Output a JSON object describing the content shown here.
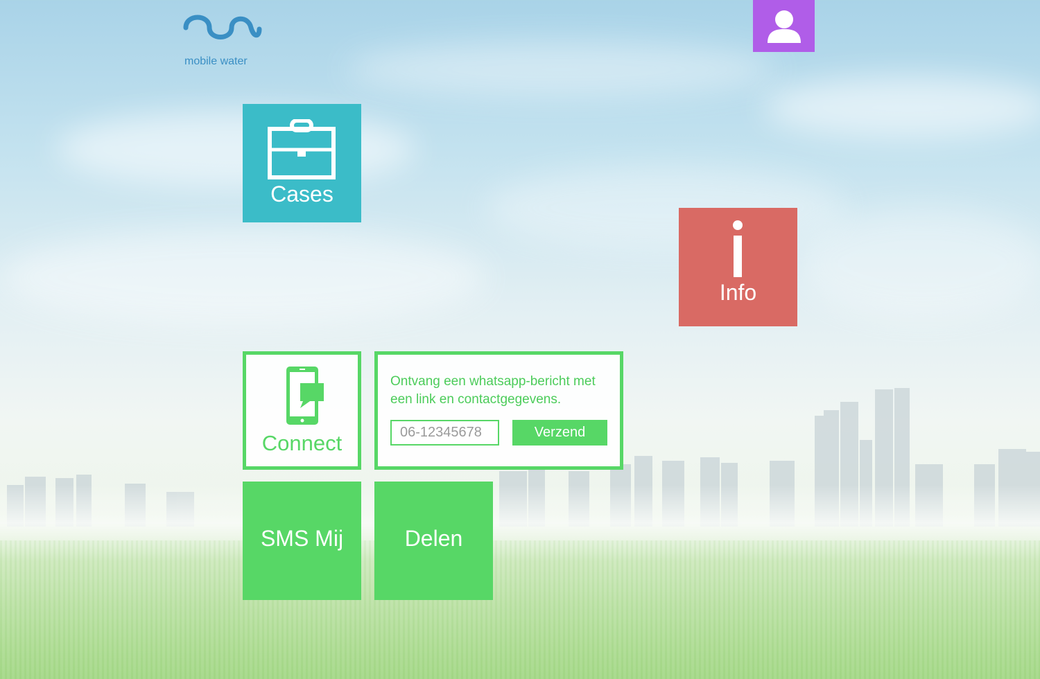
{
  "brand": {
    "name": "mobile water",
    "color": "#3a8fc4",
    "logo_icon": "wave-logo"
  },
  "header": {
    "user_icon": "user-icon",
    "user_button_color": "#b05de8"
  },
  "tiles": {
    "cases": {
      "label": "Cases",
      "icon": "briefcase-icon",
      "color": "#3bbcc8"
    },
    "info": {
      "label": "Info",
      "icon": "info-icon",
      "color": "#d96a64"
    },
    "connect": {
      "label": "Connect",
      "icon": "phone-chat-icon",
      "color": "#57d766"
    },
    "sms": {
      "label": "SMS Mij",
      "color": "#57d766"
    },
    "delen": {
      "label": "Delen",
      "color": "#57d766"
    }
  },
  "connect_panel": {
    "message": "Ontvang een whatsapp-bericht met een link en contactgegevens.",
    "phone_placeholder": "06-12345678",
    "phone_value": "",
    "send_label": "Verzend"
  }
}
